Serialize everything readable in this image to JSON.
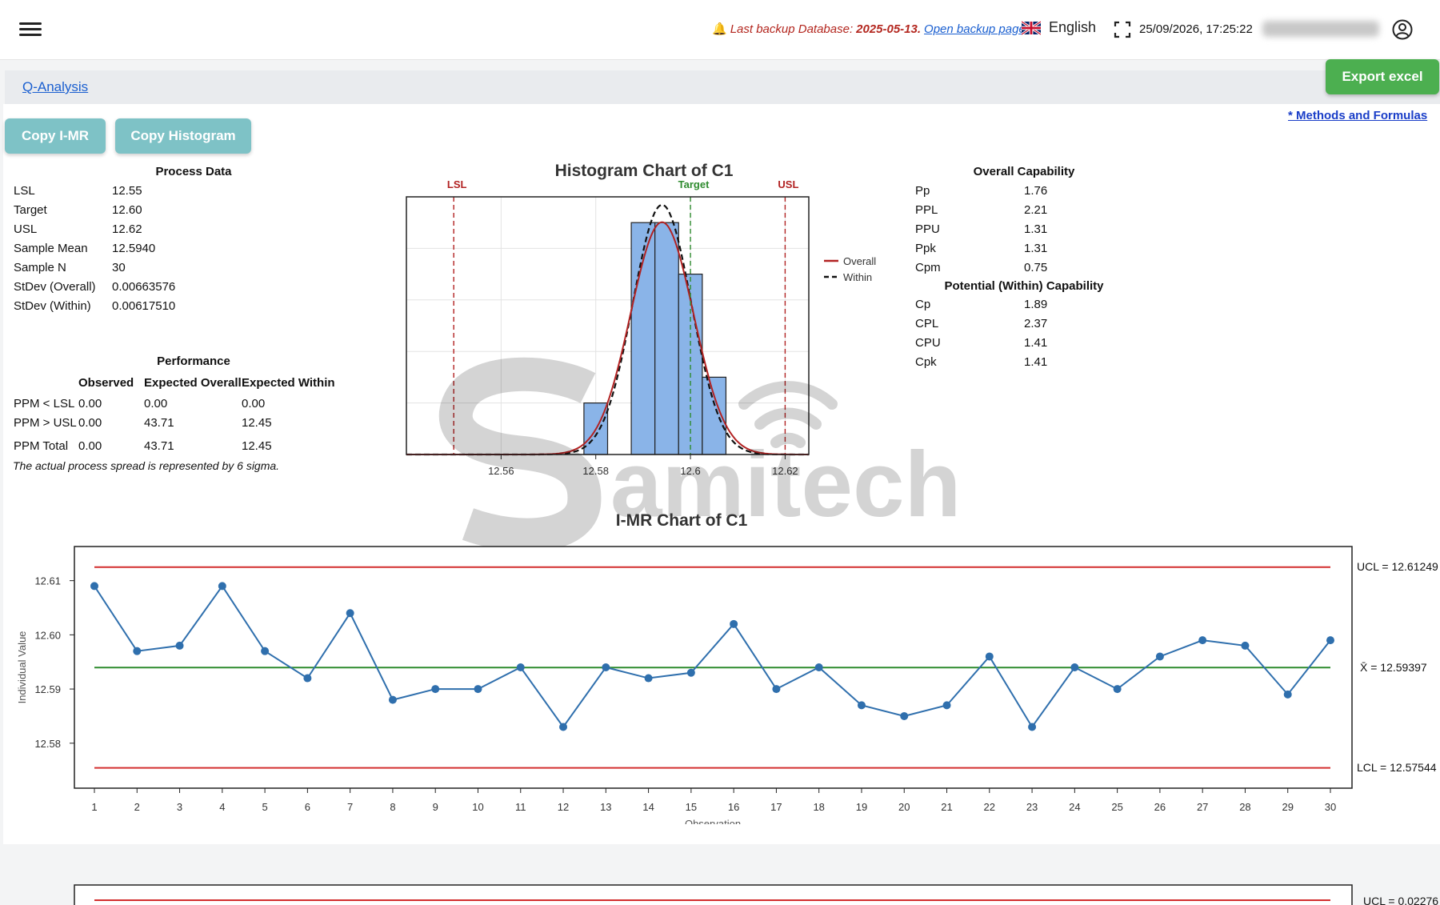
{
  "header": {
    "backup_label": "Last backup Database:",
    "backup_date": "2025-05-13.",
    "backup_link": "Open backup page",
    "language": "English",
    "datetime": "25/09/2026, 17:25:22"
  },
  "breadcrumb": "Q-Analysis",
  "buttons": {
    "export": "Export excel",
    "copy_imr": "Copy I-MR",
    "copy_histogram": "Copy Histogram",
    "methods": "* Methods and Formulas"
  },
  "process_data": {
    "title": "Process Data",
    "rows": [
      {
        "label": "LSL",
        "value": "12.55"
      },
      {
        "label": "Target",
        "value": "12.60"
      },
      {
        "label": "USL",
        "value": "12.62"
      },
      {
        "label": "Sample Mean",
        "value": "12.5940"
      },
      {
        "label": "Sample N",
        "value": "30"
      },
      {
        "label": "StDev (Overall)",
        "value": "0.00663576"
      },
      {
        "label": "StDev (Within)",
        "value": "0.00617510"
      }
    ]
  },
  "performance": {
    "title": "Performance",
    "columns": [
      "Observed",
      "Expected Overall",
      "Expected Within"
    ],
    "rows": [
      {
        "label": "PPM < LSL",
        "observed": "0.00",
        "overall": "0.00",
        "within": "0.00"
      },
      {
        "label": "PPM > USL",
        "observed": "0.00",
        "overall": "43.71",
        "within": "12.45"
      },
      {
        "label": "PPM Total",
        "observed": "0.00",
        "overall": "43.71",
        "within": "12.45"
      }
    ],
    "note": "The actual process spread is represented by 6 sigma."
  },
  "overall_capability": {
    "title": "Overall Capability",
    "rows": [
      {
        "label": "Pp",
        "value": "1.76"
      },
      {
        "label": "PPL",
        "value": "2.21"
      },
      {
        "label": "PPU",
        "value": "1.31"
      },
      {
        "label": "Ppk",
        "value": "1.31"
      },
      {
        "label": "Cpm",
        "value": "0.75"
      }
    ]
  },
  "within_capability": {
    "title": "Potential (Within) Capability",
    "rows": [
      {
        "label": "Cp",
        "value": "1.89"
      },
      {
        "label": "CPL",
        "value": "2.37"
      },
      {
        "label": "CPU",
        "value": "1.41"
      },
      {
        "label": "Cpk",
        "value": "1.41"
      }
    ]
  },
  "watermark": "Samitech",
  "colors": {
    "bars": "#8ab4e8",
    "overall": "#b22222",
    "within": "#111111",
    "limits": "#d32f2f",
    "center": "#2e8b2e",
    "points": "#2f6fad",
    "link": "#1a5fd0",
    "export": "#4caf50",
    "copy": "#7ec2c6"
  },
  "chart_data": [
    {
      "type": "bar",
      "title": "Histogram Chart of C1",
      "bins": [
        {
          "x0": 12.5775,
          "x1": 12.5825,
          "count": 2
        },
        {
          "x0": 12.5825,
          "x1": 12.5875,
          "count": 0
        },
        {
          "x0": 12.5875,
          "x1": 12.5925,
          "count": 9
        },
        {
          "x0": 12.5925,
          "x1": 12.5975,
          "count": 9
        },
        {
          "x0": 12.5975,
          "x1": 12.6025,
          "count": 7
        },
        {
          "x0": 12.6025,
          "x1": 12.6075,
          "count": 3
        }
      ],
      "xlim": [
        12.54,
        12.625
      ],
      "x_ticks": [
        12.56,
        12.58,
        12.6,
        12.62
      ],
      "x_tick_labels": [
        "12.56",
        "12.58",
        "12.6",
        "12.62"
      ],
      "ymax": 10,
      "mean": 12.594,
      "stdev_overall": 0.00663576,
      "stdev_within": 0.0061751,
      "reference_lines": [
        {
          "label": "LSL",
          "value": 12.55
        },
        {
          "label": "Target",
          "value": 12.6
        },
        {
          "label": "USL",
          "value": 12.62
        }
      ],
      "legend": [
        "Overall",
        "Within"
      ],
      "legend_position": "right",
      "grid": true
    },
    {
      "type": "line",
      "title": "I-MR Chart of C1",
      "xlabel": "Observation",
      "ylabel": "Individual Value",
      "x": [
        1,
        2,
        3,
        4,
        5,
        6,
        7,
        8,
        9,
        10,
        11,
        12,
        13,
        14,
        15,
        16,
        17,
        18,
        19,
        20,
        21,
        22,
        23,
        24,
        25,
        26,
        27,
        28,
        29,
        30
      ],
      "values": [
        12.609,
        12.597,
        12.598,
        12.609,
        12.597,
        12.592,
        12.604,
        12.588,
        12.59,
        12.59,
        12.594,
        12.583,
        12.594,
        12.592,
        12.593,
        12.602,
        12.59,
        12.594,
        12.587,
        12.585,
        12.587,
        12.596,
        12.583,
        12.594,
        12.59,
        12.596,
        12.599,
        12.598,
        12.589,
        12.599
      ],
      "ylim": [
        12.5717,
        12.6163
      ],
      "y_ticks": [
        "12.58",
        "12.59",
        "12.60",
        "12.61"
      ],
      "ucl": 12.61249,
      "center": 12.59397,
      "lcl": 12.57544,
      "ucl_label": "UCL = 12.61249",
      "center_label": "X̄ = 12.59397",
      "lcl_label": "LCL = 12.57544"
    },
    {
      "type": "line",
      "title": "",
      "values": [],
      "ucl_label": "UCL = 0.02276"
    }
  ]
}
